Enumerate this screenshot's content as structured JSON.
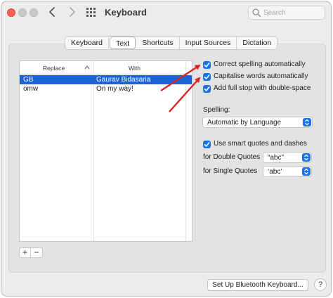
{
  "window": {
    "title": "Keyboard"
  },
  "search": {
    "placeholder": "Search"
  },
  "tabs": [
    {
      "label": "Keyboard"
    },
    {
      "label": "Text",
      "active": true
    },
    {
      "label": "Shortcuts"
    },
    {
      "label": "Input Sources"
    },
    {
      "label": "Dictation"
    }
  ],
  "table": {
    "headers": {
      "replace": "Replace",
      "with": "With"
    },
    "rows": [
      {
        "replace": "GB",
        "with": "Gaurav Bidasaria",
        "selected": true
      },
      {
        "replace": "omw",
        "with": "On my way!",
        "selected": false
      }
    ]
  },
  "controls": {
    "add": "+",
    "remove": "−"
  },
  "options": {
    "correct_spelling": {
      "label": "Correct spelling automatically",
      "checked": true
    },
    "capitalise": {
      "label": "Capitalise words automatically",
      "checked": true
    },
    "full_stop": {
      "label": "Add full stop with double-space",
      "checked": true
    },
    "spelling_label": "Spelling:",
    "spelling_value": "Automatic by Language",
    "smart_quotes": {
      "label": "Use smart quotes and dashes",
      "checked": true
    },
    "double_quotes_label": "for Double Quotes",
    "double_quotes_value": "“abc”",
    "single_quotes_label": "for Single Quotes",
    "single_quotes_value": "‘abc’"
  },
  "footer": {
    "bluetooth_button": "Set Up Bluetooth Keyboard...",
    "help": "?"
  },
  "colors": {
    "accent": "#1a72e8",
    "selection": "#1a63d6",
    "annotation_arrow": "#d92525"
  },
  "icons": [
    "back-chevron-icon",
    "forward-chevron-icon",
    "grid-icon",
    "search-icon",
    "sort-up-icon",
    "checkmark-icon",
    "popup-chevrons-icon"
  ]
}
